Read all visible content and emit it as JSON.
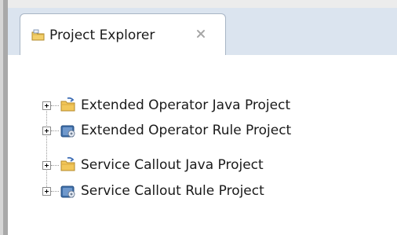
{
  "view": {
    "title": "Project Explorer",
    "close_icon": "close-icon",
    "view_icon": "project-explorer-icon"
  },
  "tree": {
    "items": [
      {
        "label": "Extended Operator Java Project",
        "icon": "java-project-folder-icon"
      },
      {
        "label": "Extended Operator Rule Project",
        "icon": "rule-project-icon"
      },
      {
        "label": "Service Callout Java Project",
        "icon": "java-project-folder-icon"
      },
      {
        "label": "Service Callout Rule Project",
        "icon": "rule-project-icon"
      }
    ]
  },
  "colors": {
    "tab_strip": "#dbe4ef",
    "tab_border": "#a8b5c5",
    "folder_yellow": "#f2c75a",
    "rule_blue": "#3f6fa8"
  }
}
